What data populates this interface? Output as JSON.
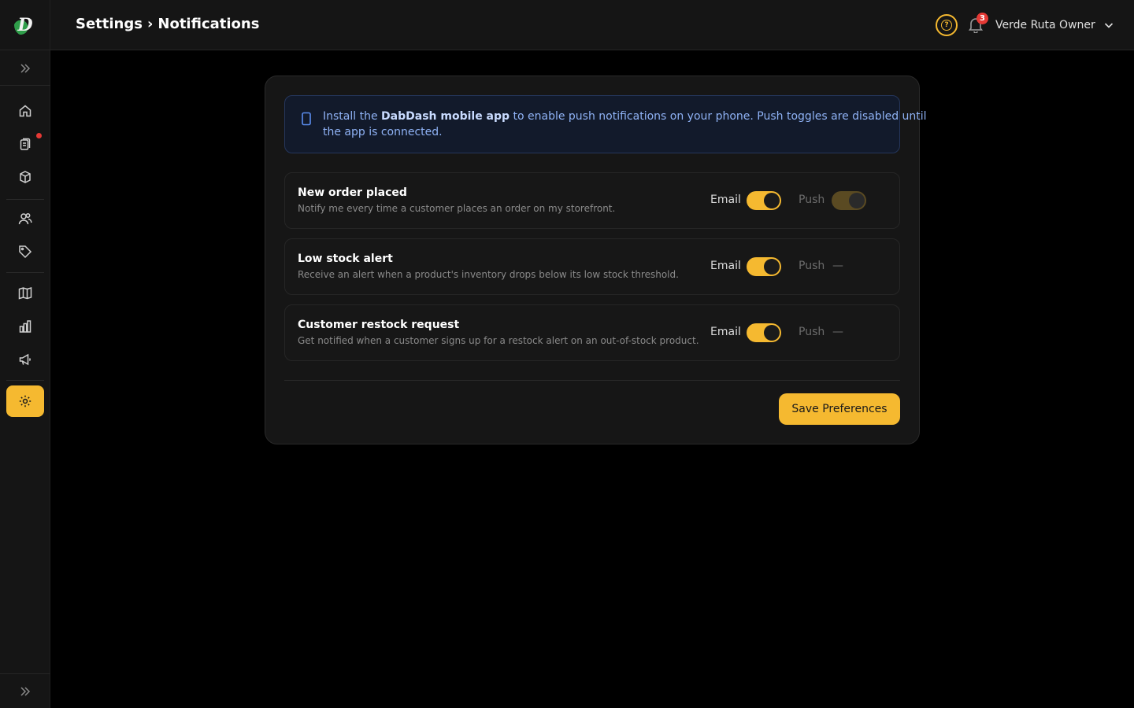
{
  "app": {
    "logo_letter": "D"
  },
  "header": {
    "crumbs": [
      "Settings",
      "›",
      "Notifications"
    ],
    "help_glyph": "?",
    "notifications_count": "3",
    "user_name": "Verde Ruta Owner"
  },
  "sidebar": {
    "items": [
      {
        "name": "home",
        "icon": "home-icon",
        "active": false,
        "dot": false
      },
      {
        "name": "orders",
        "icon": "clipboard-icon",
        "active": false,
        "dot": true
      },
      {
        "name": "products",
        "icon": "box-icon",
        "active": false,
        "dot": false
      },
      {
        "name": "customers",
        "icon": "users-icon",
        "active": false,
        "dot": false
      },
      {
        "name": "discounts",
        "icon": "tag-icon",
        "active": false,
        "dot": false
      },
      {
        "name": "catalog",
        "icon": "book-icon",
        "active": false,
        "dot": false
      },
      {
        "name": "analytics",
        "icon": "bar-chart-icon",
        "active": false,
        "dot": false
      },
      {
        "name": "marketing",
        "icon": "megaphone-icon",
        "active": false,
        "dot": false
      },
      {
        "name": "settings",
        "icon": "gear-icon",
        "active": true,
        "dot": false
      }
    ]
  },
  "banner": {
    "prefix": "Install the ",
    "app_name": "DabDash mobile app",
    "line1_suffix": " to enable push notifications on your phone. Push toggles are disabled until",
    "line2": "the app is connected."
  },
  "preferences": [
    {
      "title": "New order placed",
      "description": "Notify me every time a customer places an order on my storefront.",
      "email_label": "Email",
      "email_on": true,
      "push_label": "Push",
      "push_state": "toggle-disabled"
    },
    {
      "title": "Low stock alert",
      "description": "Receive an alert when a product's inventory drops below its low stock threshold.",
      "email_label": "Email",
      "email_on": true,
      "push_label": "Push",
      "push_state": "unavailable",
      "push_placeholder": "—"
    },
    {
      "title": "Customer restock request",
      "description": "Get notified when a customer signs up for a restock alert on an out-of-stock product.",
      "email_label": "Email",
      "email_on": true,
      "push_label": "Push",
      "push_state": "unavailable",
      "push_placeholder": "—"
    }
  ],
  "actions": {
    "save_label": "Save Preferences"
  },
  "colors": {
    "accent": "#f5b930",
    "badge": "#e53935",
    "info": "#8fb2f5"
  }
}
